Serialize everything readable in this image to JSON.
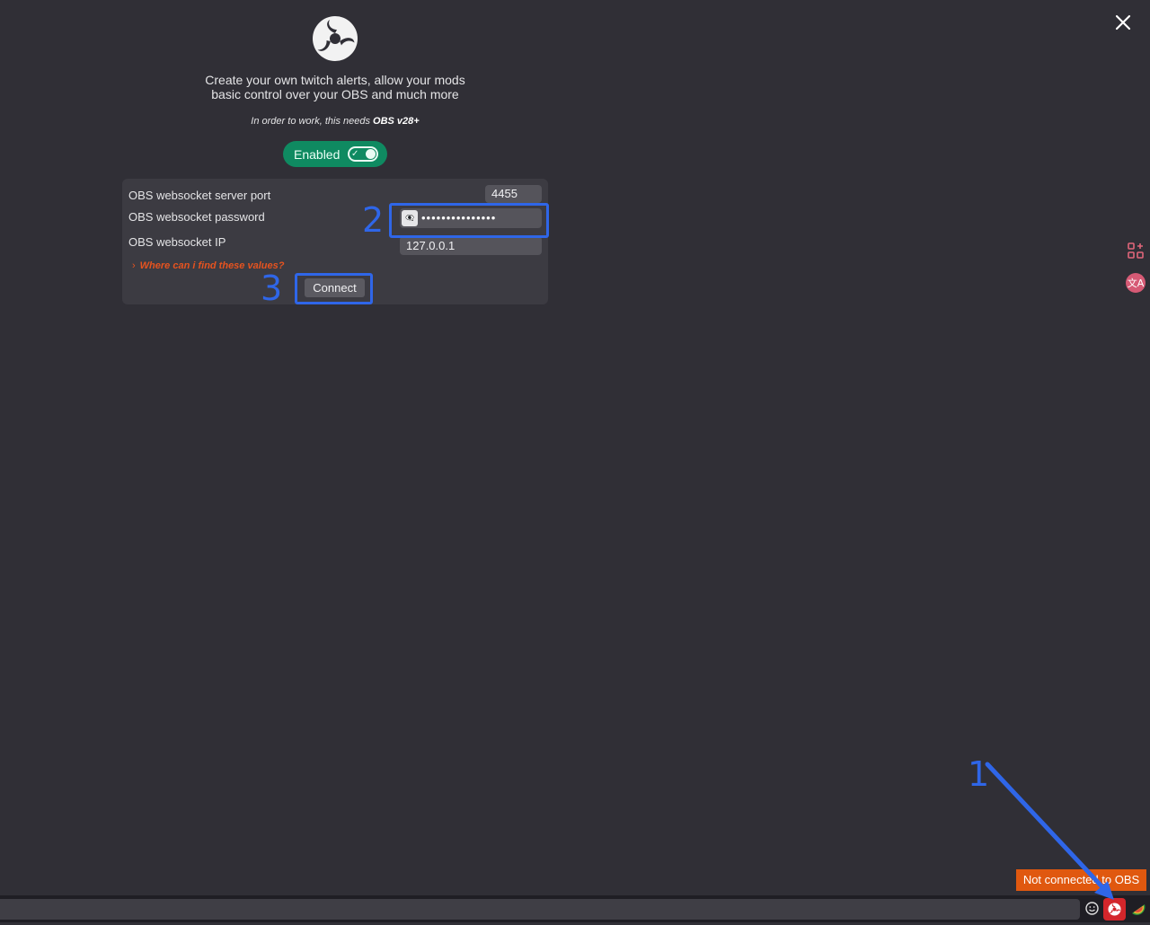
{
  "obs_panel": {
    "description_line1": "Create your own twitch alerts, allow your mods",
    "description_line2": "basic control over your OBS and much more",
    "requirement_prefix": "In order to work, this needs ",
    "requirement_version": "OBS v28+",
    "toggle_label": "Enabled",
    "toggle_state": "on",
    "form": {
      "port_label": "OBS websocket server port",
      "port_value": "4455",
      "password_label": "OBS websocket password",
      "password_masked": "•••••••••••••••",
      "ip_label": "OBS websocket IP",
      "ip_value": "127.0.0.1",
      "help_link": "Where can i find these values?",
      "connect_label": "Connect"
    }
  },
  "annotations": {
    "step1": "1",
    "step2": "2",
    "step3": "3"
  },
  "status": {
    "tooltip": "Not connected to OBS"
  },
  "colors": {
    "background": "#302f36",
    "accent_green": "#0f8a61",
    "link_orange": "#e6531f",
    "annotation_blue": "#2f66e8",
    "obs_button_red": "#d3262b",
    "tooltip_orange": "#e0580f"
  },
  "icons": {
    "close": "close-icon",
    "logo": "obs-logo-icon",
    "eye": "eye-icon",
    "grid": "grid-plus-icon",
    "translate": "translate-icon",
    "emoji": "emoji-icon",
    "obs": "obs-icon",
    "melon": "watermelon-icon"
  }
}
